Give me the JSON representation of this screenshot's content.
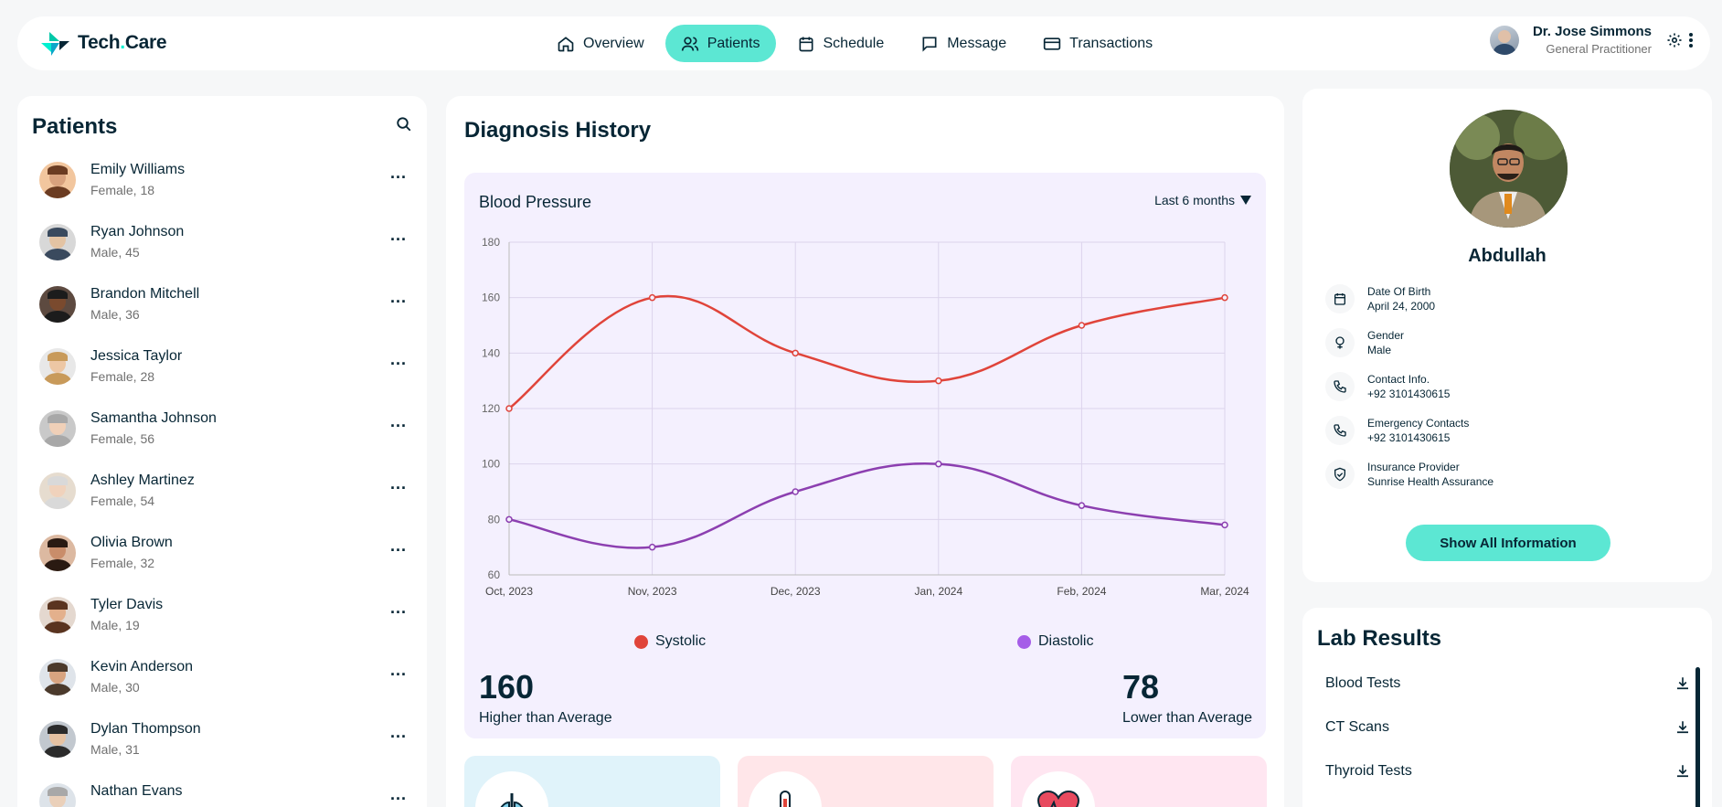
{
  "app": {
    "logo_main": "Tech",
    "logo_dot": ".",
    "logo_tail": "Care"
  },
  "nav": [
    {
      "label": "Overview",
      "icon": "home-icon"
    },
    {
      "label": "Patients",
      "icon": "users-icon",
      "active": true
    },
    {
      "label": "Schedule",
      "icon": "calendar-icon"
    },
    {
      "label": "Message",
      "icon": "message-icon"
    },
    {
      "label": "Transactions",
      "icon": "credit-card-icon"
    }
  ],
  "doctor": {
    "name": "Dr. Jose Simmons",
    "role": "General Practitioner"
  },
  "patients_panel": {
    "title": "Patients",
    "more_label": "...",
    "items": [
      {
        "name": "Emily Williams",
        "meta": "Female, 18"
      },
      {
        "name": "Ryan Johnson",
        "meta": "Male, 45"
      },
      {
        "name": "Brandon Mitchell",
        "meta": "Male, 36"
      },
      {
        "name": "Jessica Taylor",
        "meta": "Female, 28"
      },
      {
        "name": "Samantha Johnson",
        "meta": "Female, 56"
      },
      {
        "name": "Ashley Martinez",
        "meta": "Female, 54"
      },
      {
        "name": "Olivia Brown",
        "meta": "Female, 32"
      },
      {
        "name": "Tyler Davis",
        "meta": "Male, 19"
      },
      {
        "name": "Kevin Anderson",
        "meta": "Male, 30"
      },
      {
        "name": "Dylan Thompson",
        "meta": "Male, 31"
      },
      {
        "name": "Nathan Evans",
        "meta": ""
      }
    ]
  },
  "diagnosis": {
    "title": "Diagnosis History",
    "bp_title": "Blood Pressure",
    "range_label": "Last 6 months",
    "systolic": {
      "value": "160",
      "label": "Higher than Average"
    },
    "diastolic": {
      "value": "78",
      "label": "Lower than Average"
    }
  },
  "chart_data": {
    "type": "line",
    "title": "Blood Pressure",
    "x": [
      "Oct, 2023",
      "Nov, 2023",
      "Dec, 2023",
      "Jan, 2024",
      "Feb, 2024",
      "Mar, 2024"
    ],
    "ylim": [
      60,
      180
    ],
    "yticks": [
      60,
      80,
      100,
      120,
      140,
      160,
      180
    ],
    "grid": true,
    "series": [
      {
        "name": "Systolic",
        "values": [
          120,
          160,
          140,
          130,
          150,
          160
        ],
        "color": "#e0443a",
        "legend_color": "#e66fd2"
      },
      {
        "name": "Diastolic",
        "values": [
          80,
          70,
          90,
          100,
          85,
          78
        ],
        "color": "#8c3fb0",
        "legend_color": "#8c6fe6"
      }
    ],
    "legend_position": "bottom"
  },
  "vitals_colors": [
    "#e0f3fa",
    "#ffe6e9",
    "#ffe6f1"
  ],
  "profile": {
    "name": "Abdullah",
    "fields": [
      {
        "label": "Date Of Birth",
        "value": "April 24, 2000",
        "icon": "calendar-icon"
      },
      {
        "label": "Gender",
        "value": "Male",
        "icon": "gender-icon"
      },
      {
        "label": "Contact Info.",
        "value": "+92 3101430615",
        "icon": "phone-icon"
      },
      {
        "label": "Emergency Contacts",
        "value": "+92 3101430615",
        "icon": "phone-icon"
      },
      {
        "label": "Insurance Provider",
        "value": "Sunrise Health Assurance",
        "icon": "shield-icon"
      }
    ],
    "button": "Show All Information"
  },
  "lab_results": {
    "title": "Lab Results",
    "items": [
      "Blood Tests",
      "CT Scans",
      "Thyroid Tests"
    ]
  },
  "colors": {
    "accent": "#5ce7d3",
    "text": "#072635",
    "chart_bg": "#f4f0fe"
  }
}
